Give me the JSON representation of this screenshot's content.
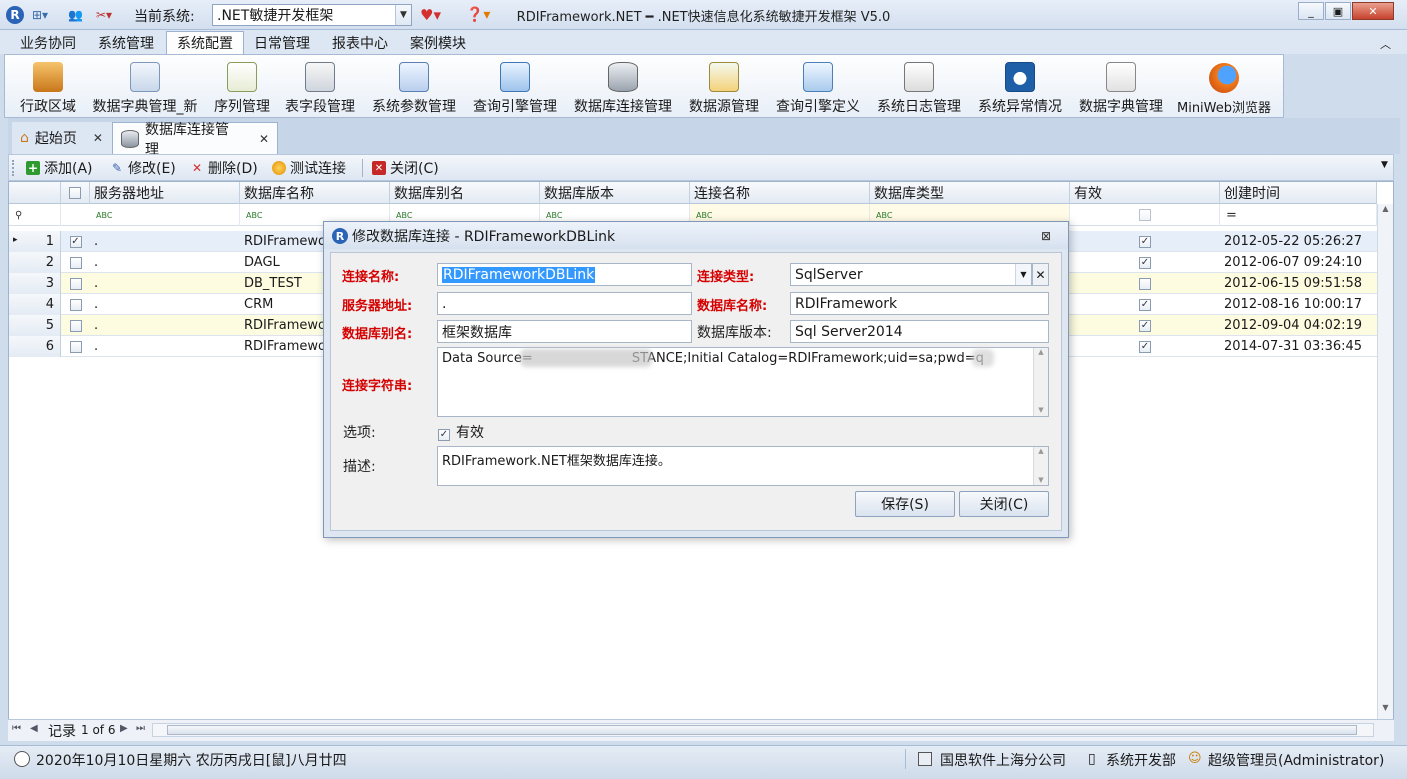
{
  "titlebar": {
    "current_system_label": "当前系统:",
    "current_system_value": ".NET敏捷开发框架",
    "app_title": "RDIFramework.NET ━ .NET快速信息化系统敏捷开发框架 V5.0"
  },
  "menu": {
    "tabs": [
      "业务协同",
      "系统管理",
      "系统配置",
      "日常管理",
      "报表中心",
      "案例模块"
    ],
    "active": "系统配置"
  },
  "ribbon": {
    "items": [
      "行政区域",
      "数据字典管理_新",
      "序列管理",
      "表字段管理",
      "系统参数管理",
      "查询引擎管理",
      "数据库连接管理",
      "数据源管理",
      "查询引擎定义",
      "系统日志管理",
      "系统异常情况",
      "数据字典管理",
      "MiniWeb浏览器"
    ]
  },
  "doc_tabs": {
    "home": "起始页",
    "current": "数据库连接管理"
  },
  "toolbar": {
    "add": "添加(A)",
    "edit": "修改(E)",
    "delete": "删除(D)",
    "test": "测试连接",
    "close": "关闭(C)"
  },
  "grid": {
    "columns": [
      "服务器地址",
      "数据库名称",
      "数据库别名",
      "数据库版本",
      "连接名称",
      "数据库类型",
      "有效",
      "创建时间"
    ],
    "filter_eq": "=",
    "rows": [
      {
        "num": "1",
        "server": ".",
        "dbname": "RDIFramewor",
        "valid": true,
        "created": "2012-05-22 05:26:27"
      },
      {
        "num": "2",
        "server": ".",
        "dbname": "DAGL",
        "valid": true,
        "created": "2012-06-07 09:24:10"
      },
      {
        "num": "3",
        "server": ".",
        "dbname": "DB_TEST",
        "valid": false,
        "created": "2012-06-15 09:51:58"
      },
      {
        "num": "4",
        "server": ".",
        "dbname": "CRM",
        "valid": true,
        "created": "2012-08-16 10:00:17"
      },
      {
        "num": "5",
        "server": ".",
        "dbname": "RDIFramewor",
        "valid": true,
        "created": "2012-09-04 04:02:19"
      },
      {
        "num": "6",
        "server": ".",
        "dbname": "RDIFramewor",
        "valid": true,
        "created": "2014-07-31 03:36:45"
      }
    ],
    "nav_record": "记录",
    "nav_of": "1 of 6"
  },
  "dialog": {
    "title": "修改数据库连接 - RDIFrameworkDBLink",
    "conn_name_label": "连接名称:",
    "conn_name": "RDIFrameworkDBLink",
    "conn_type_label": "连接类型:",
    "conn_type": "SqlServer",
    "server_label": "服务器地址:",
    "server": ".",
    "dbname_label": "数据库名称:",
    "dbname": "RDIFramework",
    "alias_label": "数据库别名:",
    "alias": "框架数据库",
    "version_label": "数据库版本:",
    "version": "Sql Server2014",
    "connstr_label": "连接字符串:",
    "connstr": "Data Source=                        STANCE;Initial Catalog=RDIFramework;uid=sa;pwd=q",
    "options_label": "选项:",
    "valid_label": "有效",
    "desc_label": "描述:",
    "desc": "RDIFramework.NET框架数据库连接。",
    "save": "保存(S)",
    "close": "关闭(C)"
  },
  "status": {
    "date": "2020年10月10日星期六 农历丙戌日[鼠]八月廿四",
    "company": "国思软件上海分公司",
    "dept": "系统开发部",
    "user": "超级管理员(Administrator)"
  }
}
